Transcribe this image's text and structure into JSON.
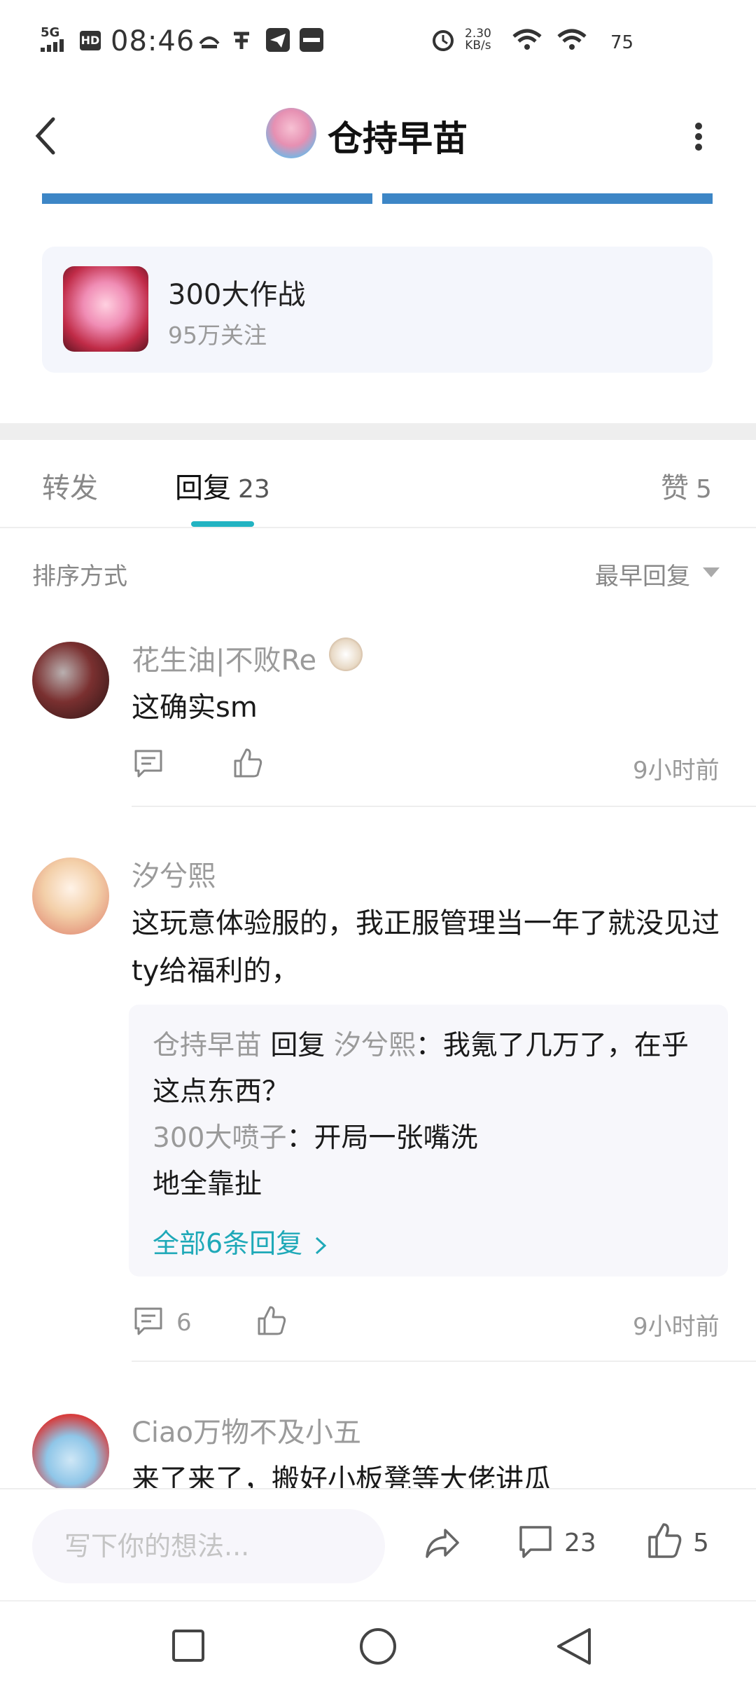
{
  "status_bar": {
    "network": "5G",
    "hd": "HD",
    "time": "08:46",
    "speed_value": "2.30",
    "speed_unit": "KB/s",
    "battery": "75"
  },
  "header": {
    "title": "仓持早苗"
  },
  "game_card": {
    "name": "300大作战",
    "followers": "95万关注"
  },
  "tabs": [
    {
      "label": "转发",
      "count": ""
    },
    {
      "label": "回复",
      "count": "23"
    },
    {
      "label": "赞",
      "count": "5"
    }
  ],
  "sort": {
    "label": "排序方式",
    "value": "最早回复"
  },
  "comments": [
    {
      "user": "花生油|不败Re",
      "text": "这确实sm",
      "time": "9小时前",
      "comment_count": "",
      "avatar_color": "#3a1f1f"
    },
    {
      "user": "汐兮熙",
      "text": "这玩意体验服的，我正服管理当一年了就没见过ty给福利的，",
      "time": "9小时前",
      "comment_count": "6",
      "replies": [
        {
          "author": "仓持早苗",
          "verb": "回复",
          "target": "汐兮熙",
          "text": "：我氪了几万了，在乎这点东西？"
        },
        {
          "author": "300大喷子",
          "text": "：开局一张嘴洗地全靠扯"
        }
      ],
      "all_replies": "全部6条回复"
    },
    {
      "user": "Ciao万物不及小五",
      "text": "来了来了，搬好小板凳等大佬讲瓜"
    }
  ],
  "bottom_bar": {
    "placeholder": "写下你的想法...",
    "comment_count": "23",
    "like_count": "5"
  },
  "colors": {
    "accent": "#22b3c2",
    "link": "#1fa9b8",
    "muted": "#9a9a9a"
  }
}
